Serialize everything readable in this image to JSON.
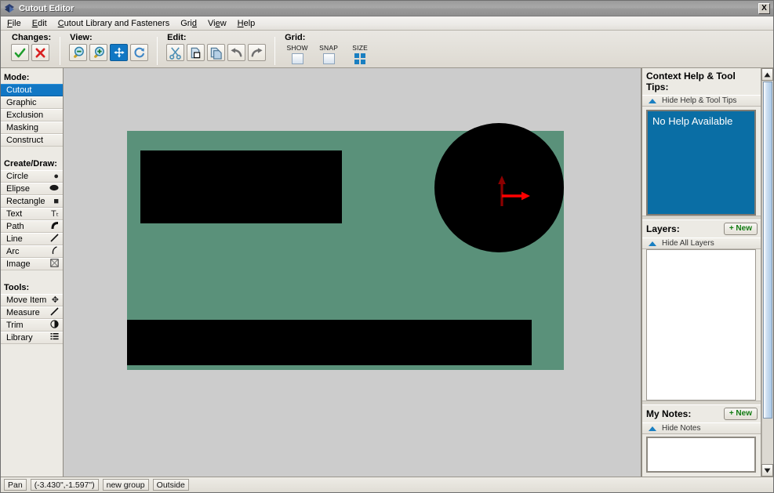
{
  "window": {
    "title": "Cutout Editor",
    "close_label": "X",
    "app_icon": "diamond-logo-icon"
  },
  "menubar": {
    "items": [
      {
        "label": "File",
        "accel": "F"
      },
      {
        "label": "Edit",
        "accel": "E"
      },
      {
        "label": "Cutout Library and Fasteners",
        "accel": "C"
      },
      {
        "label": "Grid",
        "accel": "d"
      },
      {
        "label": "View",
        "accel": "e"
      },
      {
        "label": "Help",
        "accel": "H"
      }
    ]
  },
  "toolbar": {
    "groups": [
      {
        "label": "Changes:",
        "buttons": [
          {
            "name": "accept-changes-button",
            "icon": "check-icon",
            "glyph": "✓",
            "color": "#1f9d2b",
            "active": false
          },
          {
            "name": "reject-changes-button",
            "icon": "cross-icon",
            "glyph": "✕",
            "color": "#d92121",
            "active": false
          }
        ]
      },
      {
        "label": "View:",
        "buttons": [
          {
            "name": "zoom-out-button",
            "icon": "magnifier-minus-icon",
            "active": false
          },
          {
            "name": "zoom-in-button",
            "icon": "magnifier-plus-icon",
            "active": false
          },
          {
            "name": "pan-button",
            "icon": "move-arrows-icon",
            "active": true
          },
          {
            "name": "refresh-button",
            "icon": "refresh-icon",
            "active": false
          }
        ]
      },
      {
        "label": "Edit:",
        "buttons": [
          {
            "name": "cut-button",
            "icon": "scissors-icon",
            "active": false
          },
          {
            "name": "paste-button",
            "icon": "paste-icon",
            "active": false
          },
          {
            "name": "copy-button",
            "icon": "copy-icon",
            "active": false
          },
          {
            "name": "undo-button",
            "icon": "undo-arrow-icon",
            "active": false
          },
          {
            "name": "redo-button",
            "icon": "redo-arrow-icon",
            "active": false
          }
        ]
      }
    ],
    "grid": {
      "label": "Grid:",
      "show_label": "SHOW",
      "snap_label": "SNAP",
      "size_label": "SIZE",
      "show_checked": false,
      "snap_checked": false
    }
  },
  "sidebar": {
    "mode": {
      "title": "Mode:",
      "items": [
        {
          "label": "Cutout",
          "selected": true
        },
        {
          "label": "Graphic",
          "selected": false
        },
        {
          "label": "Exclusion",
          "selected": false
        },
        {
          "label": "Masking",
          "selected": false
        },
        {
          "label": "Construct",
          "selected": false
        }
      ]
    },
    "create_draw": {
      "title": "Create/Draw:",
      "items": [
        {
          "label": "Circle",
          "icon": "filled-circle-icon",
          "glyph": "●"
        },
        {
          "label": "Elipse",
          "icon": "filled-ellipse-icon",
          "glyph": "⬬"
        },
        {
          "label": "Rectangle",
          "icon": "filled-square-icon",
          "glyph": "■"
        },
        {
          "label": "Text",
          "icon": "text-tool-icon",
          "glyph": "Tₜ"
        },
        {
          "label": "Path",
          "icon": "path-curve-icon",
          "glyph": "◠"
        },
        {
          "label": "Line",
          "icon": "line-icon",
          "glyph": "╱"
        },
        {
          "label": "Arc",
          "icon": "arc-icon",
          "glyph": "◝"
        },
        {
          "label": "Image",
          "icon": "image-placeholder-icon",
          "glyph": "⊠"
        }
      ]
    },
    "tools": {
      "title": "Tools:",
      "items": [
        {
          "label": "Move Item",
          "icon": "move-item-icon",
          "glyph": "✥"
        },
        {
          "label": "Measure",
          "icon": "ruler-icon",
          "glyph": "╱"
        },
        {
          "label": "Trim",
          "icon": "trim-icon",
          "glyph": "◕"
        },
        {
          "label": "Library",
          "icon": "list-icon",
          "glyph": "≣"
        }
      ]
    }
  },
  "canvas": {
    "artboard_color": "#5a917a",
    "background_color": "#cccccc",
    "shape_color": "#000000",
    "axis": {
      "x_arrow_color": "#ff0000",
      "y_arrow_color": "#8b0000",
      "name": "origin-axis-indicator"
    },
    "shapes": [
      {
        "name": "cutout-rectangle-top",
        "type": "rectangle"
      },
      {
        "name": "cutout-rectangle-bottom",
        "type": "rectangle"
      },
      {
        "name": "cutout-circle",
        "type": "circle"
      }
    ]
  },
  "right_panel": {
    "help": {
      "title": "Context Help & Tool Tips:",
      "toggle_label": "Hide Help & Tool Tips",
      "body_text": "No Help Available",
      "body_color": "#0a6ea5"
    },
    "layers": {
      "title": "Layers:",
      "new_label": "+ New",
      "toggle_label": "Hide All Layers",
      "items": []
    },
    "notes": {
      "title": "My Notes:",
      "new_label": "+ New",
      "toggle_label": "Hide Notes",
      "value": "",
      "placeholder": ""
    }
  },
  "statusbar": {
    "fields": [
      {
        "name": "status-mode",
        "value": "Pan"
      },
      {
        "name": "status-coordinates",
        "value": "(-3.430\",-1.597\")"
      },
      {
        "name": "status-group",
        "value": "new group"
      },
      {
        "name": "status-position",
        "value": "Outside"
      }
    ]
  }
}
